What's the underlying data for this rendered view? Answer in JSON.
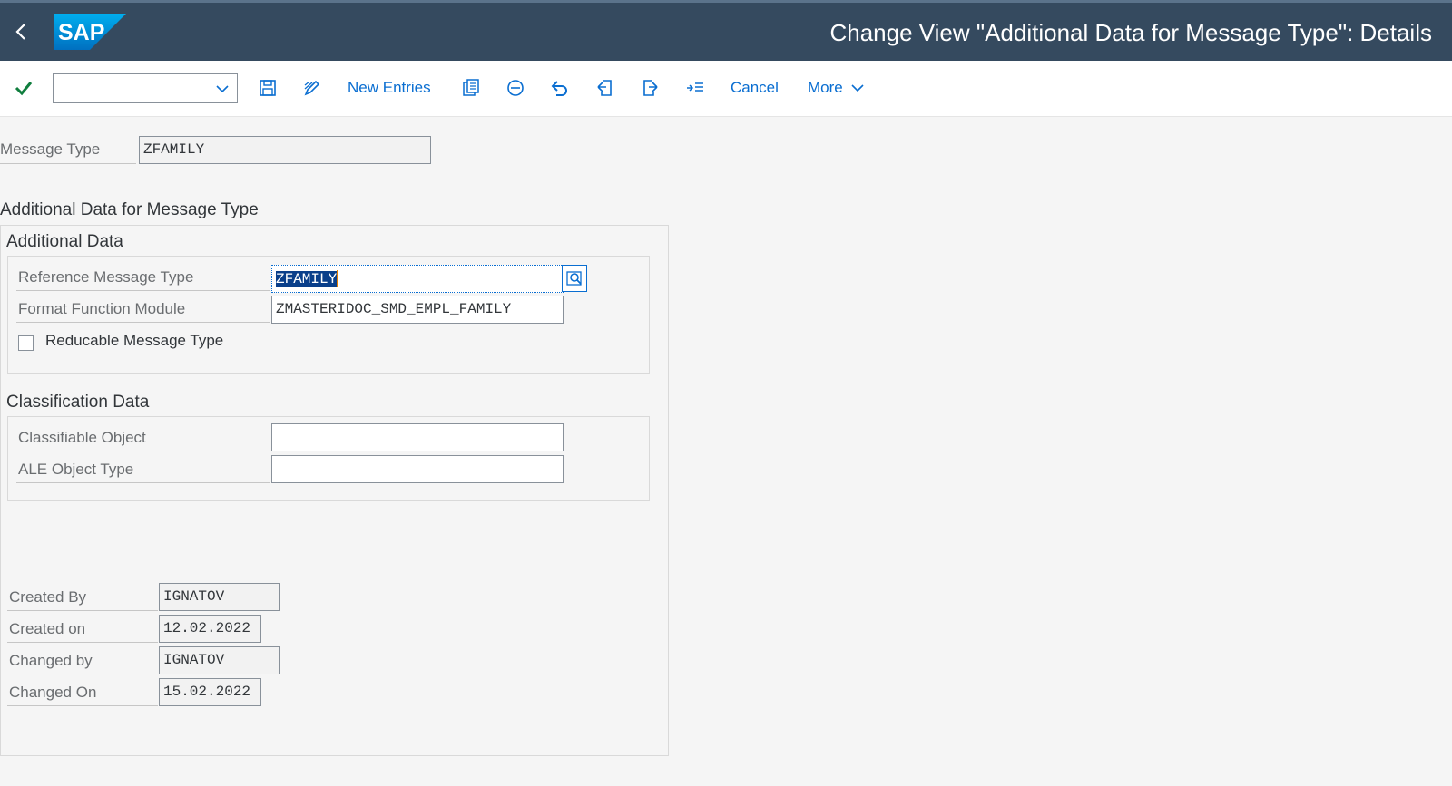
{
  "header": {
    "title": "Change View \"Additional Data for Message Type\": Details",
    "logo_text": "SAP",
    "back_icon": "chevron-left-icon"
  },
  "toolbar": {
    "command_field_value": "",
    "new_entries_label": "New Entries",
    "cancel_label": "Cancel",
    "more_label": "More",
    "icons": [
      "check-icon",
      "save-icon",
      "display-change-icon",
      "copy-as-icon",
      "delete-icon",
      "undo-icon",
      "previous-entry-icon",
      "next-entry-icon",
      "select-block-icon",
      "chevron-down-icon"
    ]
  },
  "header_fields": {
    "message_type_label": "Message Type",
    "message_type_value": "ZFAMILY"
  },
  "sections": {
    "main_title": "Additional Data for Message Type",
    "additional_data": {
      "title": "Additional Data",
      "reference_message_type_label": "Reference Message Type",
      "reference_message_type_value": "ZFAMILY",
      "format_function_module_label": "Format Function Module",
      "format_function_module_value": "ZMASTERIDOC_SMD_EMPL_FAMILY",
      "reducable_label": "Reducable Message Type",
      "reducable_checked": false
    },
    "classification_data": {
      "title": "Classification Data",
      "classifiable_object_label": "Classifiable Object",
      "classifiable_object_value": "",
      "ale_object_type_label": "ALE Object Type",
      "ale_object_type_value": ""
    },
    "admin": {
      "created_by_label": "Created By",
      "created_by_value": "IGNATOV",
      "created_on_label": "Created on",
      "created_on_value": "12.02.2022",
      "changed_by_label": "Changed by",
      "changed_by_value": "IGNATOV",
      "changed_on_label": "Changed On",
      "changed_on_value": "15.02.2022"
    }
  },
  "colors": {
    "shell": "#354a5f",
    "accent": "#0a6ed1",
    "ok_green": "#107e3e"
  }
}
